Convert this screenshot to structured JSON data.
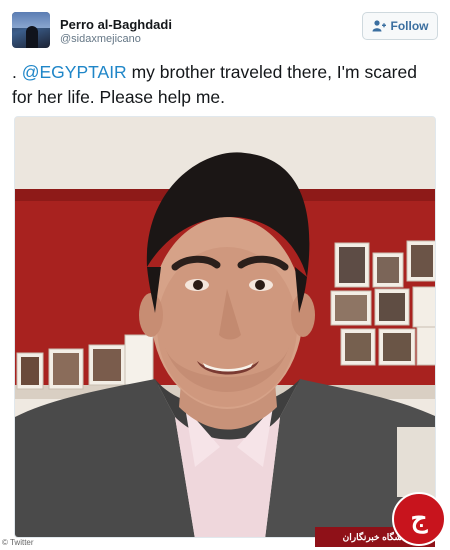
{
  "tweet": {
    "display_name": "Perro al-Baghdadi",
    "handle": "@sidaxmejicano",
    "follow_label": "Follow",
    "text_prefix": ". ",
    "mention": "@EGYPTAIR",
    "text_rest": " my brother traveled there, I'm scared for her life. Please help me."
  },
  "photo": {
    "description_icon": "selfie-photo"
  },
  "credit": "© Twitter",
  "watermark": {
    "banner_text": "باشگاه خبرنگاران",
    "logo_text": "ج"
  },
  "colors": {
    "mention": "#1f86c8",
    "follow_text": "#3b6fa0",
    "watermark_red": "#c8141d"
  }
}
